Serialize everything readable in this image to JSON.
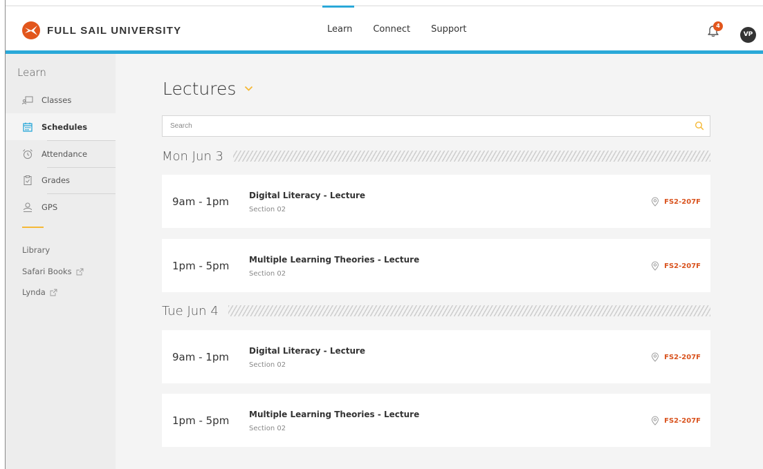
{
  "header": {
    "logo_text": "FULL SAIL UNIVERSITY",
    "nav": [
      {
        "label": "Learn",
        "active": true
      },
      {
        "label": "Connect",
        "active": false
      },
      {
        "label": "Support",
        "active": false
      }
    ],
    "notification_count": "4",
    "avatar_initials": "VP",
    "accent_color": "#2aa8d8",
    "badge_color": "#e2561c"
  },
  "sidebar": {
    "title": "Learn",
    "items": [
      {
        "label": "Classes",
        "icon": "classes-icon",
        "active": false
      },
      {
        "label": "Schedules",
        "icon": "calendar-icon",
        "active": true
      },
      {
        "label": "Attendance",
        "icon": "alarm-clock-icon",
        "active": false
      },
      {
        "label": "Grades",
        "icon": "clipboard-icon",
        "active": false
      },
      {
        "label": "GPS",
        "icon": "people-icon",
        "active": false
      }
    ],
    "links": [
      {
        "label": "Library",
        "external": false
      },
      {
        "label": "Safari Books",
        "external": true
      },
      {
        "label": "Lynda",
        "external": true
      }
    ]
  },
  "main": {
    "title": "Lectures",
    "search": {
      "placeholder": "Search",
      "value": ""
    },
    "days": [
      {
        "label": "Mon Jun 3",
        "events": [
          {
            "time": "9am - 1pm",
            "title": "Digital Literacy - Lecture",
            "section": "Section 02",
            "location": "FS2-207F"
          },
          {
            "time": "1pm - 5pm",
            "title": "Multiple Learning Theories - Lecture",
            "section": "Section 02",
            "location": "FS2-207F"
          }
        ]
      },
      {
        "label": "Tue Jun 4",
        "events": [
          {
            "time": "9am - 1pm",
            "title": "Digital Literacy - Lecture",
            "section": "Section 02",
            "location": "FS2-207F"
          },
          {
            "time": "1pm - 5pm",
            "title": "Multiple Learning Theories - Lecture",
            "section": "Section 02",
            "location": "FS2-207F"
          }
        ]
      }
    ],
    "location_color": "#d9531e"
  }
}
